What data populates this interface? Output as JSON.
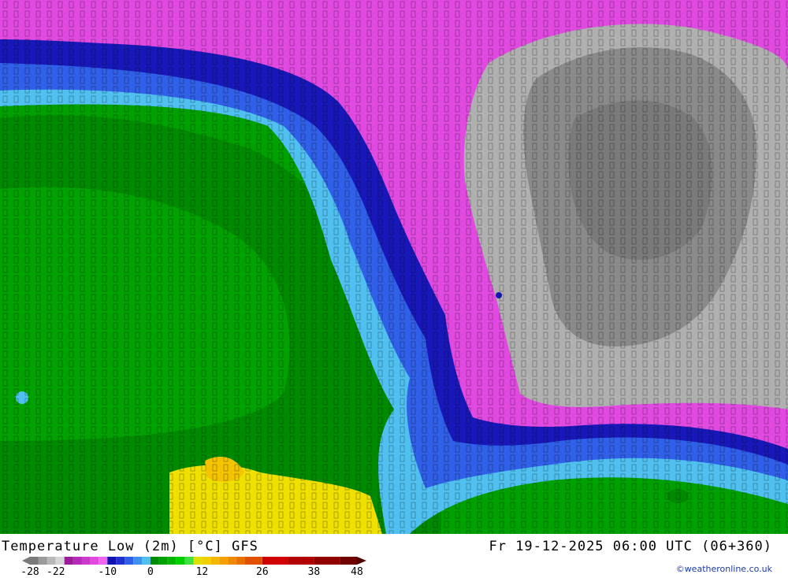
{
  "map": {
    "product": "Temperature Low (2m) [°C] GFS",
    "valid_time": "Fr 19-12-2025 06:00 UTC (06+360)",
    "credit": "©weatheronline.co.uk"
  },
  "legend": {
    "tick_labels": [
      "-28",
      "-22",
      "-10",
      "0",
      "12",
      "26",
      "38",
      "48"
    ],
    "color_stops": [
      {
        "value": -28,
        "color": "#7a7a7a"
      },
      {
        "value": -26,
        "color": "#9a9a9a"
      },
      {
        "value": -24,
        "color": "#b8b8b8"
      },
      {
        "value": -22,
        "color": "#d6d6d6"
      },
      {
        "value": -20,
        "color": "#9b1c9b"
      },
      {
        "value": -18,
        "color": "#b52bb5"
      },
      {
        "value": -16,
        "color": "#cc3acc"
      },
      {
        "value": -14,
        "color": "#e04ae0"
      },
      {
        "value": -12,
        "color": "#ee66ee"
      },
      {
        "value": -10,
        "color": "#1010b0"
      },
      {
        "value": -8,
        "color": "#2030d0"
      },
      {
        "value": -6,
        "color": "#3060e8"
      },
      {
        "value": -4,
        "color": "#4090f0"
      },
      {
        "value": -2,
        "color": "#50c0f0"
      },
      {
        "value": 0,
        "color": "#008a00"
      },
      {
        "value": 2,
        "color": "#00a000"
      },
      {
        "value": 4,
        "color": "#00b800"
      },
      {
        "value": 6,
        "color": "#00d000"
      },
      {
        "value": 8,
        "color": "#40e040"
      },
      {
        "value": 10,
        "color": "#e0e000"
      },
      {
        "value": 12,
        "color": "#f0d000"
      },
      {
        "value": 14,
        "color": "#f5b800"
      },
      {
        "value": 16,
        "color": "#f5a000"
      },
      {
        "value": 18,
        "color": "#f08800"
      },
      {
        "value": 20,
        "color": "#e87000"
      },
      {
        "value": 22,
        "color": "#e05000"
      },
      {
        "value": 26,
        "color": "#d00000"
      },
      {
        "value": 32,
        "color": "#b00000"
      },
      {
        "value": 38,
        "color": "#900000"
      },
      {
        "value": 44,
        "color": "#700000"
      },
      {
        "value": 48,
        "color": "#500000"
      }
    ]
  },
  "regions": [
    {
      "name": "cold-core",
      "label_value": "-35",
      "color": "#8a8a8a"
    },
    {
      "name": "very-cold",
      "label_value": "-25",
      "color": "#b0b0b0"
    },
    {
      "name": "cold-magenta",
      "label_value": "-15",
      "color": "#e04ae0"
    },
    {
      "name": "freezing-blue",
      "label_value": "-5",
      "color": "#3060e8"
    },
    {
      "name": "mild-green",
      "label_value": "3",
      "color": "#00a000"
    },
    {
      "name": "warm-yellow",
      "label_value": "12",
      "color": "#f0e000"
    }
  ]
}
